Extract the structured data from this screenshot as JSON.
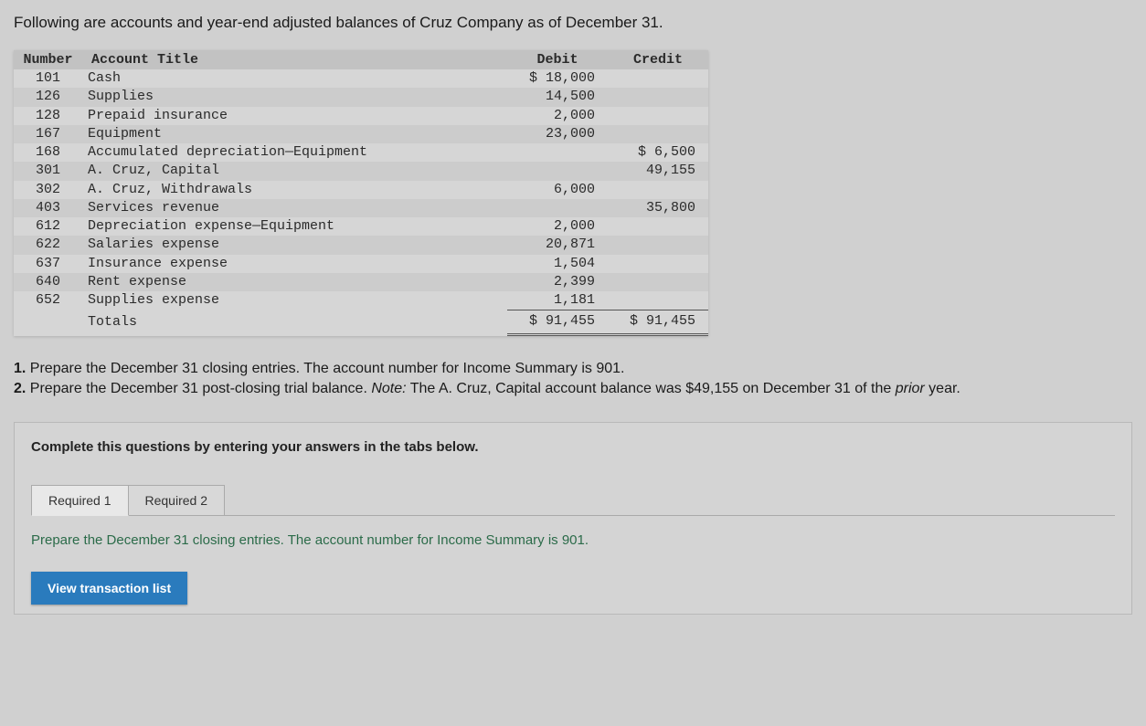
{
  "intro": "Following are accounts and year-end adjusted balances of Cruz Company as of December 31.",
  "headers": {
    "number": "Number",
    "title": "Account Title",
    "debit": "Debit",
    "credit": "Credit"
  },
  "rows": [
    {
      "num": "101",
      "title": "Cash",
      "debit": "$ 18,000",
      "credit": ""
    },
    {
      "num": "126",
      "title": "Supplies",
      "debit": "14,500",
      "credit": ""
    },
    {
      "num": "128",
      "title": "Prepaid insurance",
      "debit": "2,000",
      "credit": ""
    },
    {
      "num": "167",
      "title": "Equipment",
      "debit": "23,000",
      "credit": ""
    },
    {
      "num": "168",
      "title": "Accumulated depreciation—Equipment",
      "debit": "",
      "credit": "$ 6,500"
    },
    {
      "num": "301",
      "title": "A. Cruz, Capital",
      "debit": "",
      "credit": "49,155"
    },
    {
      "num": "302",
      "title": "A. Cruz, Withdrawals",
      "debit": "6,000",
      "credit": ""
    },
    {
      "num": "403",
      "title": "Services revenue",
      "debit": "",
      "credit": "35,800"
    },
    {
      "num": "612",
      "title": "Depreciation expense—Equipment",
      "debit": "2,000",
      "credit": ""
    },
    {
      "num": "622",
      "title": "Salaries expense",
      "debit": "20,871",
      "credit": ""
    },
    {
      "num": "637",
      "title": "Insurance expense",
      "debit": "1,504",
      "credit": ""
    },
    {
      "num": "640",
      "title": "Rent expense",
      "debit": "2,399",
      "credit": ""
    },
    {
      "num": "652",
      "title": "Supplies expense",
      "debit": "1,181",
      "credit": ""
    }
  ],
  "totals": {
    "label": "Totals",
    "debit": "$ 91,455",
    "credit": "$ 91,455"
  },
  "q1_prefix": "1. ",
  "q1_text": "Prepare the December 31 closing entries. The account number for Income Summary is 901.",
  "q2_prefix": "2. ",
  "q2_text_a": "Prepare the December 31 post-closing trial balance. ",
  "q2_note": "Note:",
  "q2_text_b": " The A. Cruz, Capital account balance was $49,155 on December 31 of the ",
  "q2_prior": "prior",
  "q2_text_c": " year.",
  "complete": "Complete this questions by entering your answers in the tabs below.",
  "tabs": {
    "r1": "Required 1",
    "r2": "Required 2"
  },
  "tab_instruction": "Prepare the December 31 closing entries. The account number for Income Summary is 901.",
  "view_btn": "View transaction list"
}
